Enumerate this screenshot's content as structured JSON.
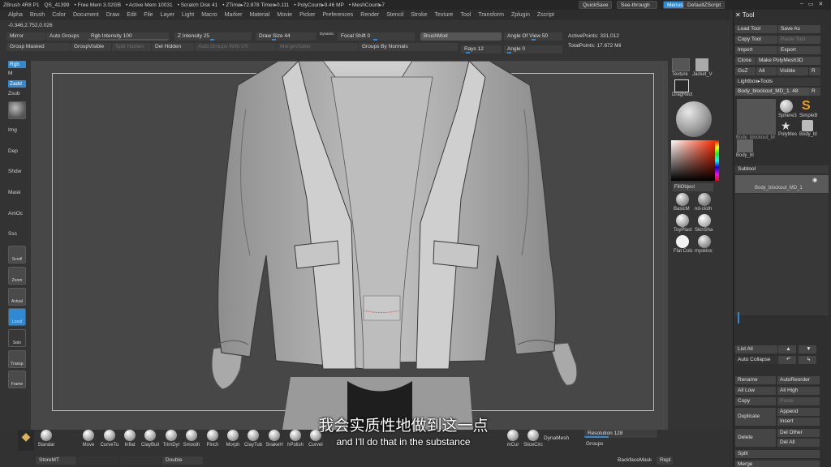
{
  "titlebar": {
    "app": "ZBrush 4R8 P1",
    "items": [
      "QS_41399",
      "• Free Mem 3.02GB",
      "• Active Mem 10031",
      "• Scratch Disk 41",
      "• ZTime▸72.878 Timer▸0.111",
      "• PolyCount▸9.46 MP",
      "• MeshCount▸7"
    ],
    "quicksave": "QuickSave",
    "seethrough": "See-through  0",
    "menus": "Menus",
    "script": "DefaultZScript"
  },
  "menu": [
    "Alpha",
    "Brush",
    "Color",
    "Document",
    "Draw",
    "Edit",
    "File",
    "Layer",
    "Light",
    "Macro",
    "Marker",
    "Material",
    "Movie",
    "Picker",
    "Preferences",
    "Render",
    "Stencil",
    "Stroke",
    "Texture",
    "Tool",
    "Transform",
    "Zplugin",
    "Zscript"
  ],
  "shelf": {
    "coords": "-0.346,2.752,0.026",
    "mirror": "Mirror",
    "auto_groups": "Auto Groups",
    "rgb_intensity": "Rgb Intensity 100",
    "z_intensity": "Z Intensity 25",
    "draw_size": "Draw Size 44",
    "dynamic": "Dynamic",
    "focal_shift": "Focal Shift 0",
    "brush_mod": "BrushMod",
    "angle_of_view": "Angle Of View 50",
    "active_points": "ActivePoints: 331,012",
    "group_masked": "Group Masked",
    "group_visible": "GroupVisible",
    "split_hidden": "Split Hidden",
    "del_hidden": "Del Hidden",
    "auto_groups_uv": "Auto Groups With UV",
    "merge_visible": "MergeVisible",
    "groups_by_normals": "Groups By Normals",
    "rays": "Rays 12",
    "angle": "Angle 0",
    "total_points": "TotalPoints: 17.672 Mil"
  },
  "left": {
    "rgb": "Rgb",
    "m": "M",
    "zadd": "Zadd",
    "zsub": "Zsub",
    "img": "Img",
    "dep": "Dep",
    "shdw": "Shdw",
    "mask": "Mask",
    "amoc": "AmOc",
    "sss": "Sss",
    "scroll": "Scroll",
    "zoom": "Zoom",
    "actual": "Actual",
    "local": "Local",
    "solo": "Solo",
    "transp": "Transp",
    "frame": "Frame"
  },
  "right": {
    "texture": "Texture",
    "jacket": "Jacket_V",
    "dragrect": "DragRect",
    "fill_object": "FillObject",
    "mats": [
      "BasicM",
      "nd-cloth",
      "ToyPlast",
      "SkinSha",
      "Flat Colc",
      "myskins"
    ]
  },
  "tool": {
    "title": "Tool",
    "load_tool": "Load Tool",
    "save_as": "Save As",
    "copy_tool": "Copy Tool",
    "paste_tool": "Paste Tool",
    "import": "Import",
    "export": "Export",
    "clone": "Clone",
    "make_polymesh": "Make PolyMesh3D",
    "goz": "GoZ",
    "all": "All",
    "visible": "Visible",
    "r": "R",
    "lightbox_tools": "Lightbox▸Tools",
    "current_tool": "Body_blockout_MD_1. 48",
    "thumbs": [
      "Body_blockout_M",
      "Sphere3",
      "SimpleB",
      "PolyMes",
      "Body_bl",
      "Body_bl"
    ],
    "subtool": "Subtool",
    "subtool_name": "Body_blockout_MD_1",
    "list_all": "List All",
    "auto_collapse": "Auto Collapse",
    "rename": "Rename",
    "autoreorder": "AutoReorder",
    "all_low": "All Low",
    "all_high": "All High",
    "copy": "Copy",
    "paste": "Paste",
    "duplicate": "Duplicate",
    "append": "Append",
    "insert": "Insert",
    "delete": "Delete",
    "del_other": "Del Other",
    "del_all": "Del All",
    "split": "Split",
    "merge": "Merge"
  },
  "bottom": {
    "standard": "Standar",
    "brushes": [
      "Move",
      "CurveTu",
      "Inflat",
      "ClayBuil",
      "TrimDyr",
      "Smooth",
      "Pinch",
      "Morph",
      "ClayTub",
      "SnakeH",
      "hPolish",
      "CurveI",
      "",
      "",
      "",
      "mCur",
      "SliceCirc"
    ],
    "dynamesh": "DynaMesh",
    "resolution": "Resolution 128",
    "groups": "Groups",
    "store_mt": "StoreMT",
    "double": "Double",
    "backface": "BackfaceMask",
    "repl": "Repl"
  },
  "subtitles": {
    "cn": "我会实质性地做到这一点",
    "en": "and I'll do that in the substance"
  }
}
